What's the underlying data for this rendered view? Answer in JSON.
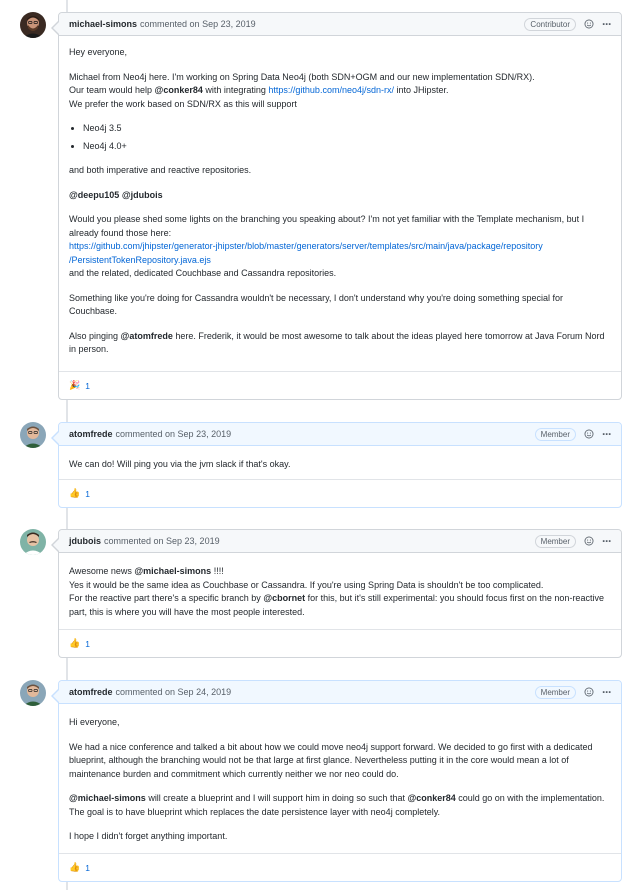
{
  "comments": [
    {
      "author": "michael-simons",
      "meta": "commented on Sep 23, 2019",
      "badge": "Contributor",
      "reaction": {
        "emoji": "🎉",
        "count": "1"
      },
      "body": {
        "p1": "Hey everyone,",
        "p2a": "Michael from Neo4j here. I'm working on Spring Data Neo4j (both SDN+OGM and our new implementation SDN/RX).",
        "p2b_pre": "Our team would help ",
        "p2b_mention": "@conker84",
        "p2b_mid": " with integrating ",
        "p2b_link": "https://github.com/neo4j/sdn-rx/",
        "p2b_post": " into JHipster.",
        "p2c": "We prefer the work based on SDN/RX as this will support",
        "li1": "Neo4j 3.5",
        "li2": "Neo4j 4.0+",
        "p3": "and both imperative and reactive repositories.",
        "p4_m1": "@deepu105",
        "p4_m2": "@jdubois",
        "p5a": "Would you please shed some lights on the branching you speaking about? I'm not yet familiar with the Template mechanism, but I already found those here:",
        "p5_link1": "https://github.com/jhipster/generator-jhipster/blob/master/generators/server/templates/src/main/java/package/repository",
        "p5_link2": "/PersistentTokenRepository.java.ejs",
        "p5b": "and the related, dedicated Couchbase and Cassandra repositories.",
        "p6": "Something like you're doing for Cassandra wouldn't be necessary, I don't understand why you're doing something special for Couchbase.",
        "p7_pre": "Also pinging ",
        "p7_mention": "@atomfrede",
        "p7_post": " here. Frederik, it would be most awesome to talk about the ideas played here tomorrow at Java Forum Nord in person."
      }
    },
    {
      "author": "atomfrede",
      "meta": "commented on Sep 23, 2019",
      "badge": "Member",
      "reaction": {
        "emoji": "👍",
        "count": "1"
      },
      "body": {
        "p1": "We can do! Will ping you via the jvm slack if that's okay."
      }
    },
    {
      "author": "jdubois",
      "meta": "commented on Sep 23, 2019",
      "badge": "Member",
      "reaction": {
        "emoji": "👍",
        "count": "1"
      },
      "body": {
        "p1_pre": "Awesome news ",
        "p1_mention": "@michael-simons",
        "p1_post": " !!!!",
        "p2": "Yes it would be the same idea as Couchbase or Cassandra. If you're using Spring Data is shouldn't be too complicated.",
        "p3_pre": "For the reactive part there's a specific branch by ",
        "p3_mention": "@cbornet",
        "p3_post": " for this, but it's still experimental: you should focus first on the non-reactive part, this is where you will have the most people interested."
      }
    },
    {
      "author": "atomfrede",
      "meta": "commented on Sep 24, 2019",
      "badge": "Member",
      "reaction": {
        "emoji": "👍",
        "count": "1"
      },
      "body": {
        "p1": "Hi everyone,",
        "p2": "We had a nice conference and talked a bit about how we could move neo4j support forward. We decided to go first with a dedicated blueprint, although the branching would not be that large at first glance. Nevertheless putting it in the core would mean a lot of maintenance burden and commitment which currently neither we nor neo could do.",
        "p3_m1": "@michael-simons",
        "p3_mid": " will create a blueprint and I will support him in doing so such that ",
        "p3_m2": "@conker84",
        "p3_post": " could go on with the implementation. The goal is to have blueprint which replaces the date persistence layer with neo4j completely.",
        "p4": "I hope I didn't forget anything important."
      }
    }
  ],
  "colors": {
    "link": "#0366d6",
    "border": "#d1d5da",
    "blue_border": "#c8e1ff",
    "header_bg": "#f6f8fa",
    "blue_header_bg": "#f1f8ff"
  },
  "icons": {
    "emoji_picker": "smiley-icon",
    "menu": "kebab-icon"
  },
  "menu_glyph": "···"
}
